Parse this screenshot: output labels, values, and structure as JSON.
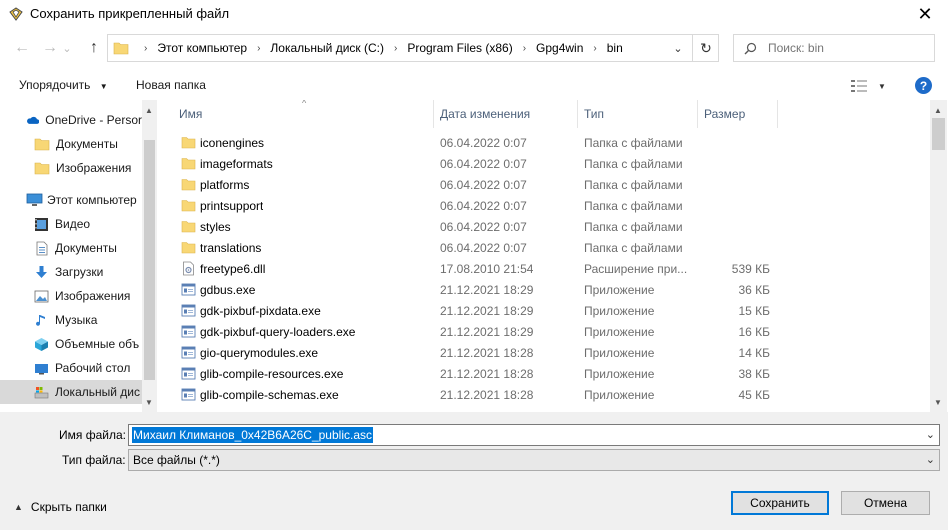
{
  "window": {
    "title": "Сохранить прикрепленный файл",
    "close_glyph": "✕"
  },
  "nav": {
    "back_glyph": "←",
    "forward_glyph": "→",
    "recent_glyph": "⌄",
    "up_glyph": "↑",
    "refresh_glyph": "↻"
  },
  "address": {
    "crumbs": [
      "Этот компьютер",
      "Локальный диск (C:)",
      "Program Files (x86)",
      "Gpg4win",
      "bin"
    ],
    "separator": "›",
    "dropdown_glyph": "⌄"
  },
  "search": {
    "placeholder": "Поиск: bin"
  },
  "commands": {
    "organize": "Упорядочить",
    "new_folder": "Новая папка",
    "help": "?"
  },
  "sidebar": {
    "items": [
      {
        "label": "OneDrive - Persor",
        "icon": "onedrive-icon"
      },
      {
        "label": "Документы",
        "icon": "folder-icon"
      },
      {
        "label": "Изображения",
        "icon": "folder-icon"
      },
      {
        "label": "Этот компьютер",
        "icon": "computer-icon"
      },
      {
        "label": "Видео",
        "icon": "video-icon"
      },
      {
        "label": "Документы",
        "icon": "documents-icon"
      },
      {
        "label": "Загрузки",
        "icon": "downloads-icon"
      },
      {
        "label": "Изображения",
        "icon": "pictures-icon"
      },
      {
        "label": "Музыка",
        "icon": "music-icon"
      },
      {
        "label": "Объемные объ",
        "icon": "3d-objects-icon"
      },
      {
        "label": "Рабочий стол",
        "icon": "desktop-icon"
      },
      {
        "label": "Локальный дис",
        "icon": "drive-icon"
      }
    ]
  },
  "columns": {
    "name": "Имя",
    "date": "Дата изменения",
    "type": "Тип",
    "size": "Размер"
  },
  "files": [
    {
      "name": "iconengines",
      "date": "06.04.2022 0:07",
      "type": "Папка с файлами",
      "size": "",
      "kind": "folder"
    },
    {
      "name": "imageformats",
      "date": "06.04.2022 0:07",
      "type": "Папка с файлами",
      "size": "",
      "kind": "folder"
    },
    {
      "name": "platforms",
      "date": "06.04.2022 0:07",
      "type": "Папка с файлами",
      "size": "",
      "kind": "folder"
    },
    {
      "name": "printsupport",
      "date": "06.04.2022 0:07",
      "type": "Папка с файлами",
      "size": "",
      "kind": "folder"
    },
    {
      "name": "styles",
      "date": "06.04.2022 0:07",
      "type": "Папка с файлами",
      "size": "",
      "kind": "folder"
    },
    {
      "name": "translations",
      "date": "06.04.2022 0:07",
      "type": "Папка с файлами",
      "size": "",
      "kind": "folder"
    },
    {
      "name": "freetype6.dll",
      "date": "17.08.2010 21:54",
      "type": "Расширение при...",
      "size": "539 КБ",
      "kind": "dll"
    },
    {
      "name": "gdbus.exe",
      "date": "21.12.2021 18:29",
      "type": "Приложение",
      "size": "36 КБ",
      "kind": "exe"
    },
    {
      "name": "gdk-pixbuf-pixdata.exe",
      "date": "21.12.2021 18:29",
      "type": "Приложение",
      "size": "15 КБ",
      "kind": "exe"
    },
    {
      "name": "gdk-pixbuf-query-loaders.exe",
      "date": "21.12.2021 18:29",
      "type": "Приложение",
      "size": "16 КБ",
      "kind": "exe"
    },
    {
      "name": "gio-querymodules.exe",
      "date": "21.12.2021 18:28",
      "type": "Приложение",
      "size": "14 КБ",
      "kind": "exe"
    },
    {
      "name": "glib-compile-resources.exe",
      "date": "21.12.2021 18:28",
      "type": "Приложение",
      "size": "38 КБ",
      "kind": "exe"
    },
    {
      "name": "glib-compile-schemas.exe",
      "date": "21.12.2021 18:28",
      "type": "Приложение",
      "size": "45 КБ",
      "kind": "exe"
    }
  ],
  "footer": {
    "filename_label": "Имя файла:",
    "filename_value": "Михаил Климанов_0x42B6A26C_public.asc",
    "filetype_label": "Тип файла:",
    "filetype_value": "Все файлы (*.*)",
    "hide_folders": "Скрыть папки",
    "save": "Сохранить",
    "cancel": "Отмена"
  },
  "colors": {
    "accent": "#0078d7",
    "folder": "#f8d775",
    "header_text": "#4c607a"
  }
}
